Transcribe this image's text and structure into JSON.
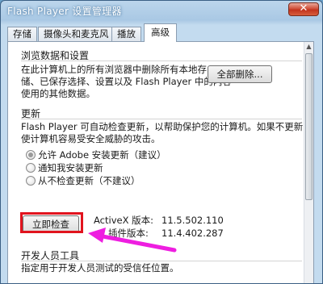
{
  "window": {
    "title": "Flash Player 设置管理器",
    "close_label": "✕"
  },
  "tabs": [
    {
      "label": "存储"
    },
    {
      "label": "摄像头和麦克风"
    },
    {
      "label": "播放"
    },
    {
      "label": "高级",
      "active": true
    }
  ],
  "browsing_data": {
    "title": "浏览数据和设置",
    "line1": "在此计算机上的所有浏览器中删除所有本地存",
    "line2": "储、已保存选择、设置以及 Flash Player 中的内容",
    "line3": "使用的其他数据。",
    "delete_all_label": "全部删除..."
  },
  "updates": {
    "title": "更新",
    "line1": "Flash Player 可自动检查更新，以帮助保护您的计算机。如果不更新，可能会",
    "line2": "使计算机容易受安全威胁的攻击。",
    "options": [
      {
        "label": "允许 Adobe 安装更新（建议）",
        "checked": true
      },
      {
        "label": "通知我安装更新",
        "checked": false
      },
      {
        "label": "从不检查更新（不建议）",
        "checked": false
      }
    ],
    "check_now_label": "立即检查",
    "activex_label": "ActiveX 版本:",
    "activex_value": "11.5.502.110",
    "plugin_label": "插件版本:",
    "plugin_value": "11.4.402.287"
  },
  "developer": {
    "title": "开发人员工具",
    "line1": "指定用于开发人员测试的受信任位置。"
  },
  "colors": {
    "highlight": "#e1141e",
    "arrow": "#ee1ee0"
  }
}
